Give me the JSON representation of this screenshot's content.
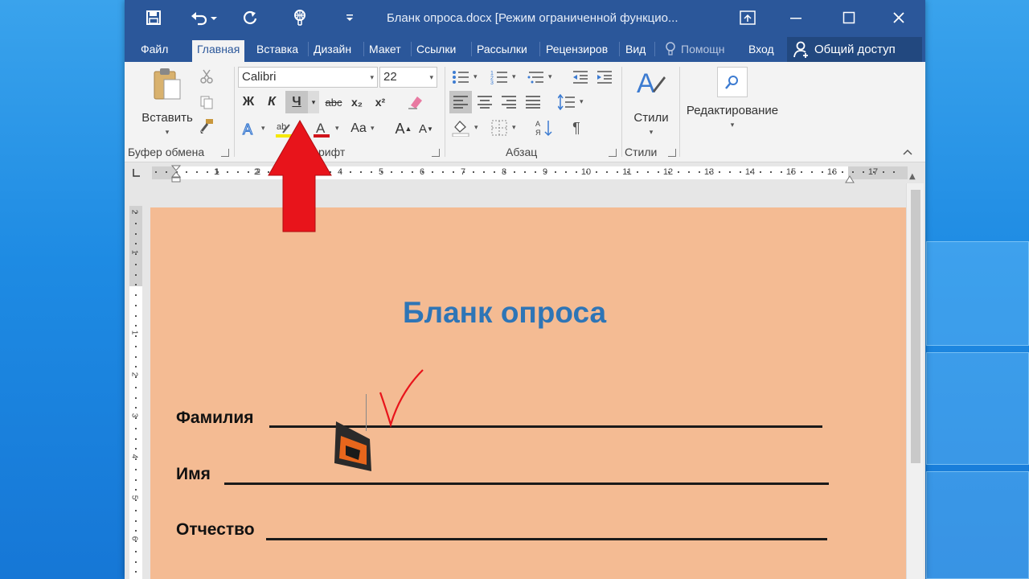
{
  "titlebar": {
    "title": "Бланк опроса.docx [Режим ограниченной функцио...",
    "quick_access": {
      "save_icon": "save-icon",
      "undo_icon": "undo-icon",
      "redo_icon": "redo-icon",
      "touch_mode_icon": "touch-mode-icon",
      "customize_icon": "customize-icon"
    },
    "window_buttons": [
      "ribbon-display-icon",
      "minimize-icon",
      "maximize-icon",
      "close-icon"
    ]
  },
  "tabs": [
    {
      "label": "Файл"
    },
    {
      "label": "Главная"
    },
    {
      "label": "Вставка"
    },
    {
      "label": "Дизайн"
    },
    {
      "label": "Макет"
    },
    {
      "label": "Ссылки"
    },
    {
      "label": "Рассылки"
    },
    {
      "label": "Рецензиров"
    },
    {
      "label": "Вид"
    }
  ],
  "tell_me": "Помощн",
  "signin": "Вход",
  "share": "Общий доступ",
  "ribbon": {
    "clipboard": {
      "paste_label": "Вставить",
      "group_label": "Буфер обмена"
    },
    "font": {
      "font_name": "Calibri",
      "font_size": "22",
      "bold": "Ж",
      "italic": "К",
      "underline": "Ч",
      "strike": "abc",
      "subscript": "x₂",
      "superscript": "x²",
      "change_case": "Aa",
      "grow": "A",
      "shrink": "A",
      "group_label": "Шрифт",
      "group_label_visible": "рифт"
    },
    "paragraph": {
      "pilcrow": "¶",
      "group_label": "Абзац"
    },
    "styles": {
      "label": "Стили",
      "group_label": "Стили"
    },
    "editing": {
      "label": "Редактирование"
    }
  },
  "ruler": {
    "numbers": [
      "2",
      "1",
      "1",
      "2",
      "3",
      "4",
      "5",
      "6",
      "7",
      "8",
      "9",
      "10",
      "11",
      "12",
      "13",
      "14",
      "15",
      "16",
      "17"
    ],
    "vertical_numbers": [
      "2",
      "1",
      "1",
      "2",
      "3",
      "4",
      "5",
      "6"
    ]
  },
  "document": {
    "title": "Бланк опроса",
    "fields": [
      {
        "label": "Фамилия"
      },
      {
        "label": "Имя"
      },
      {
        "label": "Отчество"
      }
    ]
  },
  "colors": {
    "word_blue": "#2b579a",
    "page_fill": "#f4bb93",
    "title_blue": "#2e75b6",
    "arrow_red": "#e8141b"
  }
}
